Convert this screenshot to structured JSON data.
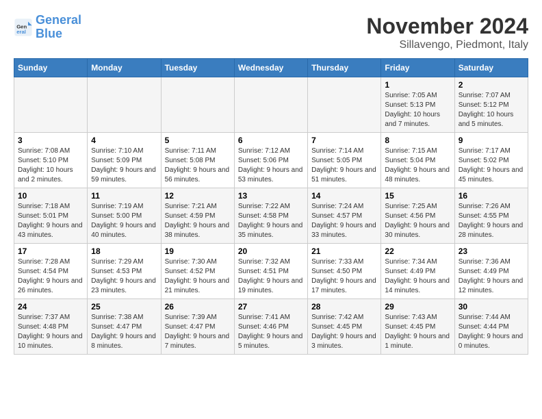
{
  "logo": {
    "line1": "General",
    "line2": "Blue"
  },
  "title": "November 2024",
  "subtitle": "Sillavengo, Piedmont, Italy",
  "weekdays": [
    "Sunday",
    "Monday",
    "Tuesday",
    "Wednesday",
    "Thursday",
    "Friday",
    "Saturday"
  ],
  "weeks": [
    [
      {
        "day": "",
        "info": ""
      },
      {
        "day": "",
        "info": ""
      },
      {
        "day": "",
        "info": ""
      },
      {
        "day": "",
        "info": ""
      },
      {
        "day": "",
        "info": ""
      },
      {
        "day": "1",
        "info": "Sunrise: 7:05 AM\nSunset: 5:13 PM\nDaylight: 10 hours and 7 minutes."
      },
      {
        "day": "2",
        "info": "Sunrise: 7:07 AM\nSunset: 5:12 PM\nDaylight: 10 hours and 5 minutes."
      }
    ],
    [
      {
        "day": "3",
        "info": "Sunrise: 7:08 AM\nSunset: 5:10 PM\nDaylight: 10 hours and 2 minutes."
      },
      {
        "day": "4",
        "info": "Sunrise: 7:10 AM\nSunset: 5:09 PM\nDaylight: 9 hours and 59 minutes."
      },
      {
        "day": "5",
        "info": "Sunrise: 7:11 AM\nSunset: 5:08 PM\nDaylight: 9 hours and 56 minutes."
      },
      {
        "day": "6",
        "info": "Sunrise: 7:12 AM\nSunset: 5:06 PM\nDaylight: 9 hours and 53 minutes."
      },
      {
        "day": "7",
        "info": "Sunrise: 7:14 AM\nSunset: 5:05 PM\nDaylight: 9 hours and 51 minutes."
      },
      {
        "day": "8",
        "info": "Sunrise: 7:15 AM\nSunset: 5:04 PM\nDaylight: 9 hours and 48 minutes."
      },
      {
        "day": "9",
        "info": "Sunrise: 7:17 AM\nSunset: 5:02 PM\nDaylight: 9 hours and 45 minutes."
      }
    ],
    [
      {
        "day": "10",
        "info": "Sunrise: 7:18 AM\nSunset: 5:01 PM\nDaylight: 9 hours and 43 minutes."
      },
      {
        "day": "11",
        "info": "Sunrise: 7:19 AM\nSunset: 5:00 PM\nDaylight: 9 hours and 40 minutes."
      },
      {
        "day": "12",
        "info": "Sunrise: 7:21 AM\nSunset: 4:59 PM\nDaylight: 9 hours and 38 minutes."
      },
      {
        "day": "13",
        "info": "Sunrise: 7:22 AM\nSunset: 4:58 PM\nDaylight: 9 hours and 35 minutes."
      },
      {
        "day": "14",
        "info": "Sunrise: 7:24 AM\nSunset: 4:57 PM\nDaylight: 9 hours and 33 minutes."
      },
      {
        "day": "15",
        "info": "Sunrise: 7:25 AM\nSunset: 4:56 PM\nDaylight: 9 hours and 30 minutes."
      },
      {
        "day": "16",
        "info": "Sunrise: 7:26 AM\nSunset: 4:55 PM\nDaylight: 9 hours and 28 minutes."
      }
    ],
    [
      {
        "day": "17",
        "info": "Sunrise: 7:28 AM\nSunset: 4:54 PM\nDaylight: 9 hours and 26 minutes."
      },
      {
        "day": "18",
        "info": "Sunrise: 7:29 AM\nSunset: 4:53 PM\nDaylight: 9 hours and 23 minutes."
      },
      {
        "day": "19",
        "info": "Sunrise: 7:30 AM\nSunset: 4:52 PM\nDaylight: 9 hours and 21 minutes."
      },
      {
        "day": "20",
        "info": "Sunrise: 7:32 AM\nSunset: 4:51 PM\nDaylight: 9 hours and 19 minutes."
      },
      {
        "day": "21",
        "info": "Sunrise: 7:33 AM\nSunset: 4:50 PM\nDaylight: 9 hours and 17 minutes."
      },
      {
        "day": "22",
        "info": "Sunrise: 7:34 AM\nSunset: 4:49 PM\nDaylight: 9 hours and 14 minutes."
      },
      {
        "day": "23",
        "info": "Sunrise: 7:36 AM\nSunset: 4:49 PM\nDaylight: 9 hours and 12 minutes."
      }
    ],
    [
      {
        "day": "24",
        "info": "Sunrise: 7:37 AM\nSunset: 4:48 PM\nDaylight: 9 hours and 10 minutes."
      },
      {
        "day": "25",
        "info": "Sunrise: 7:38 AM\nSunset: 4:47 PM\nDaylight: 9 hours and 8 minutes."
      },
      {
        "day": "26",
        "info": "Sunrise: 7:39 AM\nSunset: 4:47 PM\nDaylight: 9 hours and 7 minutes."
      },
      {
        "day": "27",
        "info": "Sunrise: 7:41 AM\nSunset: 4:46 PM\nDaylight: 9 hours and 5 minutes."
      },
      {
        "day": "28",
        "info": "Sunrise: 7:42 AM\nSunset: 4:45 PM\nDaylight: 9 hours and 3 minutes."
      },
      {
        "day": "29",
        "info": "Sunrise: 7:43 AM\nSunset: 4:45 PM\nDaylight: 9 hours and 1 minute."
      },
      {
        "day": "30",
        "info": "Sunrise: 7:44 AM\nSunset: 4:44 PM\nDaylight: 9 hours and 0 minutes."
      }
    ]
  ]
}
